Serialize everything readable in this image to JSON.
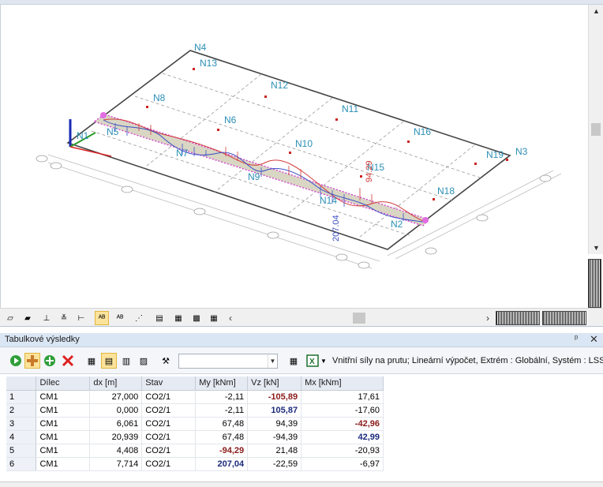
{
  "viewport": {
    "nodes": [
      "N1",
      "N2",
      "N3",
      "N4",
      "N5",
      "N6",
      "N7",
      "N8",
      "N9",
      "N10",
      "N11",
      "N12",
      "N13",
      "N14",
      "N15",
      "N16",
      "N18",
      "N19"
    ],
    "values": [
      "207.04",
      "94.29"
    ]
  },
  "panel": {
    "title": "Tabulkové výsledky",
    "pin_label": "ᵖ",
    "close_label": "✕",
    "description": "Vnitřní síly na prutu; Lineární výpočet, Extrém : Globální, Systém : LSS,",
    "combo_value": ""
  },
  "table": {
    "headers": [
      "",
      "Dílec",
      "dx [m]",
      "Stav",
      "My [kNm]",
      "Vz [kN]",
      "Mx [kNm]"
    ],
    "rows": [
      {
        "n": "1",
        "dilec": "CM1",
        "dx": "27,000",
        "stav": "CO2/1",
        "my": "-2,11",
        "vz": "-105,89",
        "mx": "17,61"
      },
      {
        "n": "2",
        "dilec": "CM1",
        "dx": "0,000",
        "stav": "CO2/1",
        "my": "-2,11",
        "vz": "105,87",
        "mx": "-17,60"
      },
      {
        "n": "3",
        "dilec": "CM1",
        "dx": "6,061",
        "stav": "CO2/1",
        "my": "67,48",
        "vz": "94,39",
        "mx": "-42,96"
      },
      {
        "n": "4",
        "dilec": "CM1",
        "dx": "20,939",
        "stav": "CO2/1",
        "my": "67,48",
        "vz": "-94,39",
        "mx": "42,99"
      },
      {
        "n": "5",
        "dilec": "CM1",
        "dx": "4,408",
        "stav": "CO2/1",
        "my": "-94,29",
        "vz": "21,48",
        "mx": "-20,93"
      },
      {
        "n": "6",
        "dilec": "CM1",
        "dx": "7,714",
        "stav": "CO2/1",
        "my": "207,04",
        "vz": "-22,59",
        "mx": "-6,97"
      }
    ]
  },
  "colors": {
    "accent_active": "#fbe39b",
    "panel_header": "#dbe6f4",
    "node_label": "#2b8fb5",
    "highlight_red": "#8b1a1a",
    "highlight_blue": "#1b2a7c"
  }
}
